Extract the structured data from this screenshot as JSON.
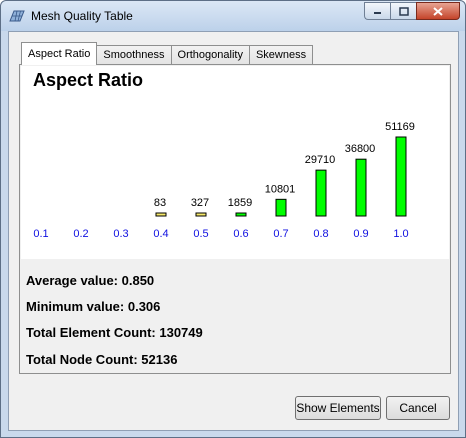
{
  "window": {
    "title": "Mesh Quality Table"
  },
  "tabs": [
    {
      "label": "Aspect Ratio",
      "active": true
    },
    {
      "label": "Smoothness",
      "active": false
    },
    {
      "label": "Orthogonality",
      "active": false
    },
    {
      "label": "Skewness",
      "active": false
    }
  ],
  "stats": {
    "average": "Average value: 0.850",
    "minimum": "Minimum value: 0.306",
    "elements": "Total Element Count: 130749",
    "nodes": "Total Node Count: 52136"
  },
  "buttons": {
    "show_elements": "Show Elements",
    "cancel": "Cancel"
  },
  "colors": {
    "bar_high": "#00ff00",
    "bar_low": "#f5e86a",
    "tick_label": "#1010e0"
  },
  "chart_data": {
    "type": "bar",
    "title": "Aspect Ratio",
    "categories": [
      "0.1",
      "0.2",
      "0.3",
      "0.4",
      "0.5",
      "0.6",
      "0.7",
      "0.8",
      "0.9",
      "1.0"
    ],
    "values": [
      0,
      0,
      0,
      83,
      327,
      1859,
      10801,
      29710,
      36800,
      51169
    ],
    "data_labels": [
      "",
      "",
      "",
      "83",
      "327",
      "1859",
      "10801",
      "29710",
      "36800",
      "51169"
    ],
    "bar_colors": [
      "#00ff00",
      "#00ff00",
      "#00ff00",
      "#f5e86a",
      "#f5e86a",
      "#00ff00",
      "#00ff00",
      "#00ff00",
      "#00ff00",
      "#00ff00"
    ],
    "grid": false,
    "legend": "none"
  }
}
